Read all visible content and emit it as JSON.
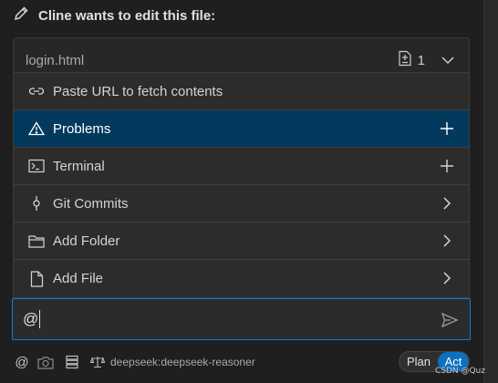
{
  "header": {
    "title": "Cline wants to edit this file:",
    "icon": "pencil-icon"
  },
  "file_card": {
    "name": "login.html",
    "diff_count": "1"
  },
  "menu": {
    "items": [
      {
        "label": "Paste URL to fetch contents",
        "icon": "link-icon",
        "trail": "",
        "selected": false
      },
      {
        "label": "Problems",
        "icon": "warning-icon",
        "trail": "plus-icon",
        "selected": true
      },
      {
        "label": "Terminal",
        "icon": "terminal-icon",
        "trail": "plus-icon",
        "selected": false
      },
      {
        "label": "Git Commits",
        "icon": "git-commit-icon",
        "trail": "chevron-right-icon",
        "selected": false
      },
      {
        "label": "Add Folder",
        "icon": "folder-icon",
        "trail": "chevron-right-icon",
        "selected": false
      },
      {
        "label": "Add File",
        "icon": "file-icon",
        "trail": "chevron-right-icon",
        "selected": false
      }
    ]
  },
  "input": {
    "value": "@"
  },
  "bottom_bar": {
    "at_label": "@",
    "model": "deepseek:deepseek-reasoner",
    "plan_label": "Plan",
    "act_label": "Act",
    "active_mode": "Act"
  },
  "watermark": "CSDN @Quz",
  "colors": {
    "background": "#1f1f1f",
    "selected_item": "#04395e",
    "focus_border": "#0e7fd1",
    "act_button": "#0e70c0"
  }
}
